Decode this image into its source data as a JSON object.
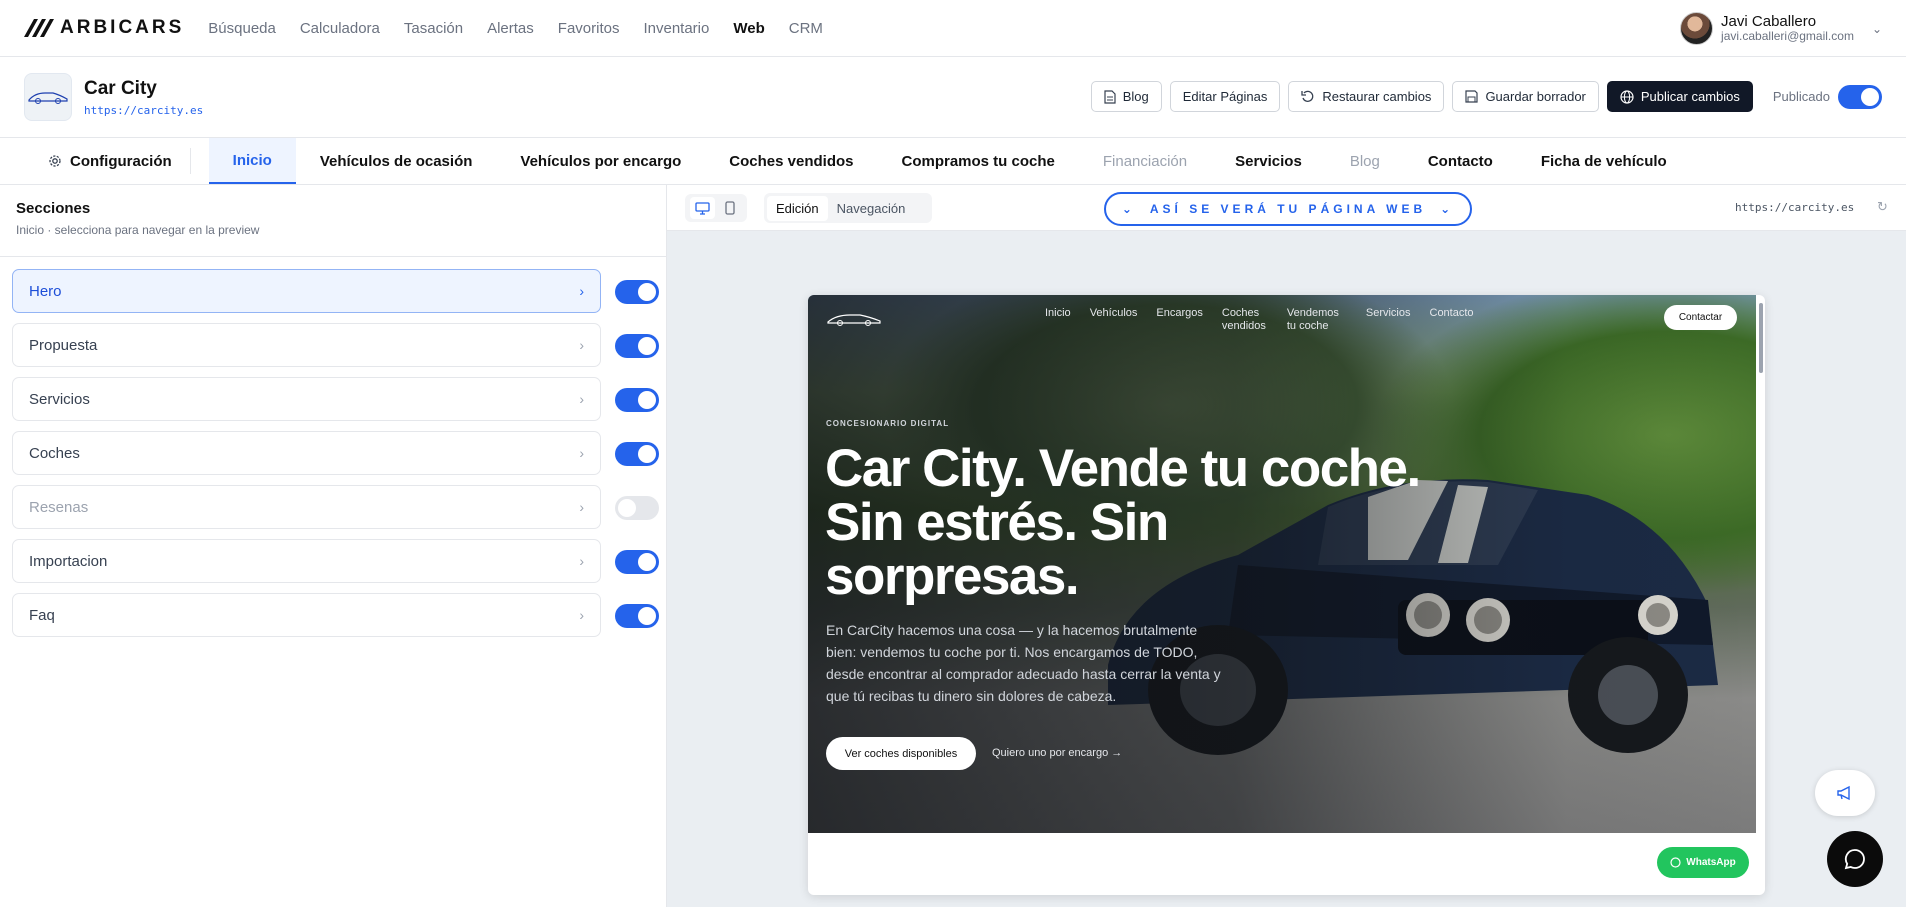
{
  "app": {
    "brand": "ARBICARS",
    "nav": [
      "Búsqueda",
      "Calculadora",
      "Tasación",
      "Alertas",
      "Favoritos",
      "Inventario",
      "Web",
      "CRM"
    ],
    "active_nav": "Web",
    "user": {
      "name": "Javi Caballero",
      "email": "javi.caballeri@gmail.com"
    }
  },
  "site": {
    "name": "Car City",
    "url": "https://carcity.es",
    "actions": {
      "blog": "Blog",
      "edit_pages": "Editar Páginas",
      "restore": "Restaurar cambios",
      "save_draft": "Guardar borrador",
      "publish": "Publicar cambios",
      "published_label": "Publicado"
    }
  },
  "tabs": {
    "config": "Configuración",
    "items": [
      "Inicio",
      "Vehículos de ocasión",
      "Vehículos por encargo",
      "Coches vendidos",
      "Compramos tu coche",
      "Financiación",
      "Servicios",
      "Blog",
      "Contacto",
      "Ficha de vehículo"
    ],
    "active": "Inicio",
    "muted": [
      "Financiación",
      "Blog"
    ]
  },
  "sections_panel": {
    "title": "Secciones",
    "subtitle": "Inicio · selecciona para navegar en la preview",
    "items": [
      {
        "label": "Hero",
        "enabled": true,
        "active": true
      },
      {
        "label": "Propuesta",
        "enabled": true
      },
      {
        "label": "Servicios",
        "enabled": true
      },
      {
        "label": "Coches",
        "enabled": true
      },
      {
        "label": "Resenas",
        "enabled": false
      },
      {
        "label": "Importacion",
        "enabled": true
      },
      {
        "label": "Faq",
        "enabled": true
      }
    ]
  },
  "preview": {
    "mode_edit": "Edición",
    "mode_nav": "Navegación",
    "banner": "ASÍ SE VERÁ TU PÁGINA WEB",
    "url": "https://carcity.es",
    "hero": {
      "nav": [
        "Inicio",
        "Vehículos",
        "Encargos",
        "Coches vendidos",
        "Vendemos tu coche",
        "Servicios",
        "Contacto"
      ],
      "cta": "Contactar",
      "eyebrow": "CONCESIONARIO DIGITAL",
      "title_1": "Car City. Vende tu coche.",
      "title_2": "Sin estrés. Sin",
      "title_3": "sorpresas.",
      "description": "En CarCity hacemos una cosa — y la hacemos brutalmente bien: vendemos tu coche por ti. Nos encargamos de TODO, desde encontrar al comprador adecuado hasta cerrar la venta y que tú recibas tu dinero sin dolores de cabeza.",
      "primary_button": "Ver coches disponibles",
      "secondary_link": "Quiero uno por encargo →"
    },
    "whatsapp": "WhatsApp"
  },
  "colors": {
    "accent": "#2563eb",
    "dark": "#111827",
    "whatsapp": "#22c55e"
  }
}
